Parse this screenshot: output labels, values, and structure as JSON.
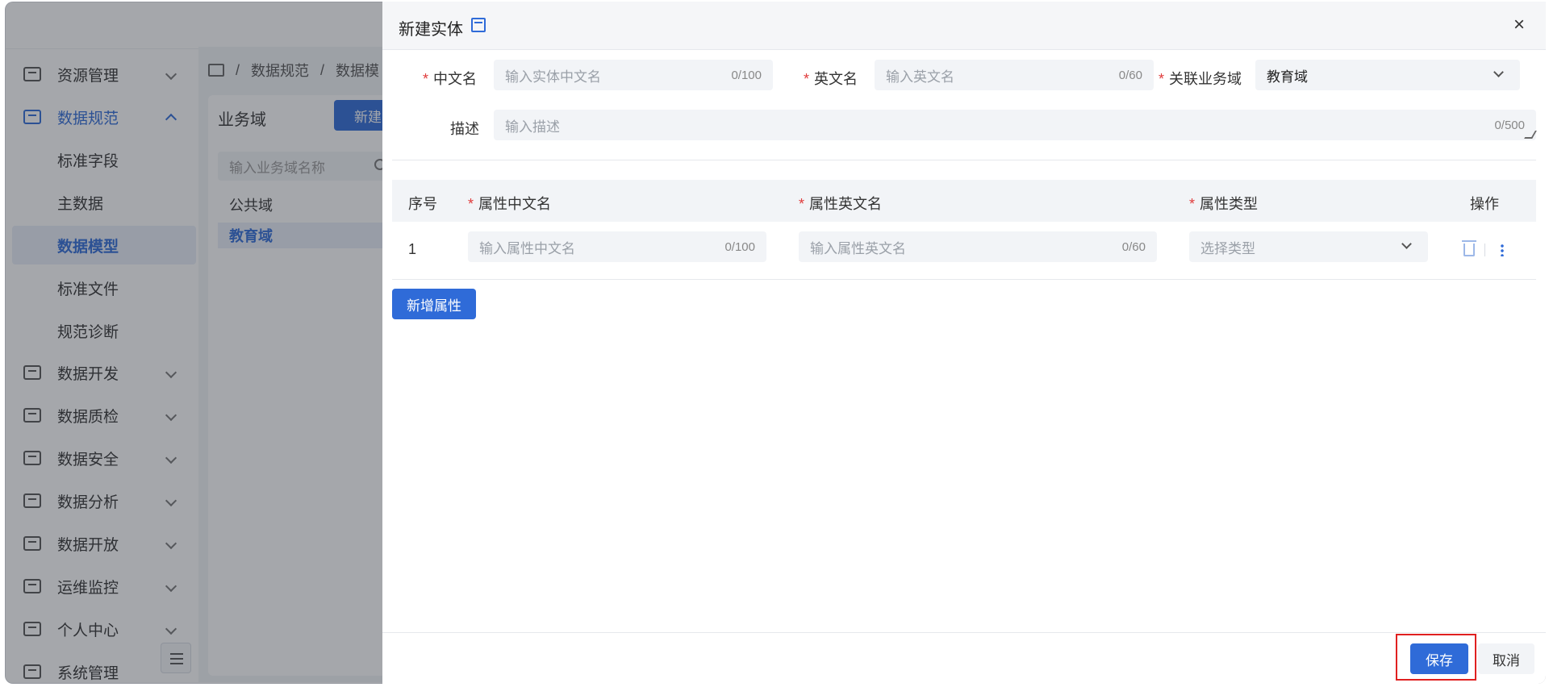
{
  "sidebar": {
    "items": [
      {
        "label": "资源管理",
        "icon": "resource-icon"
      },
      {
        "label": "数据规范",
        "icon": "monitor-icon"
      },
      {
        "label": "数据开发",
        "icon": "code-icon"
      },
      {
        "label": "数据质检",
        "icon": "inspect-icon"
      },
      {
        "label": "数据安全",
        "icon": "shield-icon"
      },
      {
        "label": "数据分析",
        "icon": "analysis-icon"
      },
      {
        "label": "数据开放",
        "icon": "open-icon"
      },
      {
        "label": "运维监控",
        "icon": "chart-icon"
      },
      {
        "label": "个人中心",
        "icon": "user-icon"
      },
      {
        "label": "系统管理",
        "icon": "gear-icon"
      }
    ],
    "sub_items": [
      "标准字段",
      "主数据",
      "数据模型",
      "标准文件",
      "规范诊断"
    ]
  },
  "breadcrumb": {
    "items": [
      "数据规范",
      "数据模"
    ]
  },
  "domain_panel": {
    "title": "业务域",
    "new_label": "新建",
    "search_placeholder": "输入业务域名称",
    "items": [
      "公共域",
      "教育域"
    ]
  },
  "drawer": {
    "title": "新建实体",
    "form": {
      "cn_name": {
        "label": "中文名",
        "placeholder": "输入实体中文名",
        "count": "0/100"
      },
      "en_name": {
        "label": "英文名",
        "placeholder": "输入英文名",
        "count": "0/60"
      },
      "domain": {
        "label": "关联业务域",
        "value": "教育域"
      },
      "desc": {
        "label": "描述",
        "placeholder": "输入描述",
        "count": "0/500"
      }
    },
    "table": {
      "headers": {
        "index": "序号",
        "cn": "属性中文名",
        "en": "属性英文名",
        "type": "属性类型",
        "ops": "操作"
      },
      "row": {
        "index": "1",
        "cn_placeholder": "输入属性中文名",
        "cn_count": "0/100",
        "en_placeholder": "输入属性英文名",
        "en_count": "0/60",
        "type_placeholder": "选择类型"
      }
    },
    "add_label": "新增属性",
    "save_label": "保存",
    "cancel_label": "取消"
  }
}
